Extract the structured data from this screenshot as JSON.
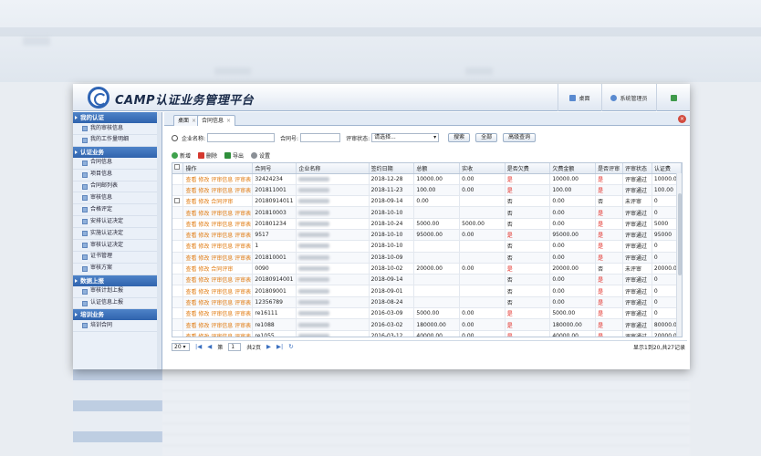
{
  "app": {
    "title": "CAMP认证业务管理平台"
  },
  "header_buttons": [
    {
      "label": "桌面",
      "icon": "desktop-icon"
    },
    {
      "label": "系统管理员",
      "icon": "user-icon"
    },
    {
      "label": "",
      "icon": "logout-icon"
    }
  ],
  "sidebar": {
    "sections": [
      {
        "title": "我的认证",
        "items": [
          "我的审核信息",
          "我的工作量明细"
        ]
      },
      {
        "title": "认证业务",
        "items": [
          "合同信息",
          "项目信息",
          "合同邮列表",
          "审核信息",
          "合格评定",
          "安排认证决定",
          "实施认证决定",
          "审核认证决定",
          "证书管理",
          "审核方案"
        ]
      },
      {
        "title": "数据上报",
        "items": [
          "审核计划上报",
          "认证信息上报"
        ]
      },
      {
        "title": "培训业务",
        "items": [
          "培训合同"
        ]
      }
    ]
  },
  "tabs": [
    {
      "label": "桌面",
      "active": false
    },
    {
      "label": "合同信息",
      "active": true
    }
  ],
  "search": {
    "company_label": "企业名称:",
    "contract_label": "合同号:",
    "status_label": "评审状态:",
    "status_value": "请选择...",
    "search_btn": "搜索",
    "all_btn": "全部",
    "advanced_btn": "高级查询"
  },
  "toolbar": {
    "add": "新增",
    "delete": "删除",
    "export": "导出",
    "settings": "设置"
  },
  "table": {
    "columns": [
      "操作",
      "合同号",
      "企业名称",
      "签约日期",
      "总额",
      "实收",
      "是否欠费",
      "欠费金额",
      "是否评审",
      "评审状态",
      "认证费"
    ],
    "op_links_full": "查看 修改 评审信息 评审表",
    "op_links_short": "查看 修改 合同评审",
    "rows": [
      {
        "short": false,
        "check": false,
        "contract": "32424234",
        "date": "2018-12-28",
        "total": "10000.00",
        "paid": "0.00",
        "owe": "是",
        "owe_amt": "10000.00",
        "reviewed": "是",
        "status": "评审通过",
        "fee": "10000.00"
      },
      {
        "short": false,
        "check": false,
        "contract": "201811001",
        "date": "2018-11-23",
        "total": "100.00",
        "paid": "0.00",
        "owe": "是",
        "owe_amt": "100.00",
        "reviewed": "是",
        "status": "评审通过",
        "fee": "100.00"
      },
      {
        "short": true,
        "check": true,
        "contract": "20180914011",
        "date": "2018-09-14",
        "total": "0.00",
        "paid": "",
        "owe": "否",
        "owe_amt": "0.00",
        "reviewed": "否",
        "status": "未评审",
        "fee": "0"
      },
      {
        "short": false,
        "check": false,
        "contract": "201810003",
        "date": "2018-10-10",
        "total": "",
        "paid": "",
        "owe": "否",
        "owe_amt": "0.00",
        "reviewed": "是",
        "status": "评审通过",
        "fee": "0"
      },
      {
        "short": false,
        "check": false,
        "contract": "201801234",
        "date": "2018-10-24",
        "total": "5000.00",
        "paid": "5000.00",
        "owe": "否",
        "owe_amt": "0.00",
        "reviewed": "是",
        "status": "评审通过",
        "fee": "5000"
      },
      {
        "short": false,
        "check": false,
        "contract": "9517",
        "date": "2018-10-10",
        "total": "95000.00",
        "paid": "0.00",
        "owe": "是",
        "owe_amt": "95000.00",
        "reviewed": "是",
        "status": "评审通过",
        "fee": "95000"
      },
      {
        "short": false,
        "check": false,
        "contract": "1",
        "date": "2018-10-10",
        "total": "",
        "paid": "",
        "owe": "否",
        "owe_amt": "0.00",
        "reviewed": "是",
        "status": "评审通过",
        "fee": "0"
      },
      {
        "short": false,
        "check": false,
        "contract": "201810001",
        "date": "2018-10-09",
        "total": "",
        "paid": "",
        "owe": "否",
        "owe_amt": "0.00",
        "reviewed": "是",
        "status": "评审通过",
        "fee": "0"
      },
      {
        "short": true,
        "check": false,
        "contract": "0090",
        "date": "2018-10-02",
        "total": "20000.00",
        "paid": "0.00",
        "owe": "是",
        "owe_amt": "20000.00",
        "reviewed": "否",
        "status": "未评审",
        "fee": "20000.00"
      },
      {
        "short": false,
        "check": false,
        "contract": "20180914001",
        "date": "2018-09-14",
        "total": "",
        "paid": "",
        "owe": "否",
        "owe_amt": "0.00",
        "reviewed": "是",
        "status": "评审通过",
        "fee": "0"
      },
      {
        "short": false,
        "check": false,
        "contract": "201809001",
        "date": "2018-09-01",
        "total": "",
        "paid": "",
        "owe": "否",
        "owe_amt": "0.00",
        "reviewed": "是",
        "status": "评审通过",
        "fee": "0"
      },
      {
        "short": false,
        "check": false,
        "contract": "12356789",
        "date": "2018-08-24",
        "total": "",
        "paid": "",
        "owe": "否",
        "owe_amt": "0.00",
        "reviewed": "是",
        "status": "评审通过",
        "fee": "0"
      },
      {
        "short": false,
        "check": false,
        "contract": "re16111",
        "date": "2016-03-09",
        "total": "5000.00",
        "paid": "0.00",
        "owe": "是",
        "owe_amt": "5000.00",
        "reviewed": "是",
        "status": "评审通过",
        "fee": "0"
      },
      {
        "short": false,
        "check": false,
        "contract": "re1088",
        "date": "2016-03-02",
        "total": "180000.00",
        "paid": "0.00",
        "owe": "是",
        "owe_amt": "180000.00",
        "reviewed": "是",
        "status": "评审通过",
        "fee": "80000.00"
      },
      {
        "short": false,
        "check": false,
        "contract": "re1055",
        "date": "2016-03-12",
        "total": "40000.00",
        "paid": "0.00",
        "owe": "是",
        "owe_amt": "40000.00",
        "reviewed": "是",
        "status": "评审通过",
        "fee": "20000.00"
      },
      {
        "short": false,
        "check": false,
        "contract": "re1087",
        "date": "",
        "total": "",
        "paid": "",
        "owe": "",
        "owe_amt": "",
        "reviewed": "",
        "status": "",
        "fee": ""
      }
    ]
  },
  "pager": {
    "page_size": "20",
    "page_label": "第",
    "page_value": "1",
    "total_pages": "共2页",
    "summary": "显示1到20,共27记录"
  },
  "colors": {
    "brand": "#2e64b4",
    "link": "#e07a10",
    "alert": "#e0221a"
  }
}
